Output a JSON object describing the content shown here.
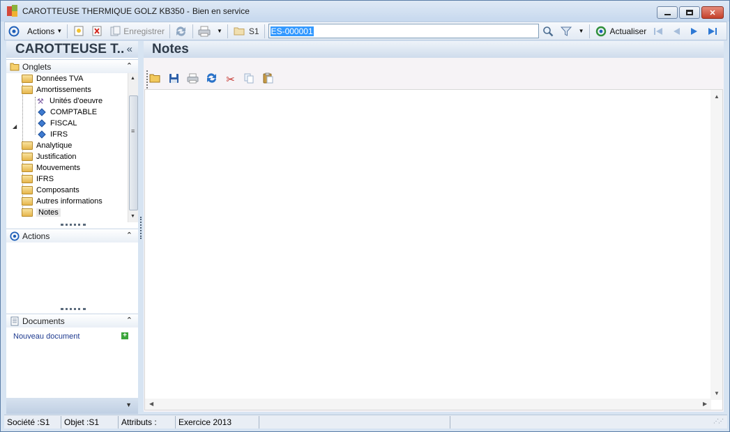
{
  "window": {
    "title": "CAROTTEUSE THERMIQUE GOLZ KB350 -",
    "status": "Bien en service",
    "buttons": {
      "minimize": "▭",
      "maximize": "□",
      "close": "✕"
    }
  },
  "toolbar": {
    "actions_label": "Actions",
    "save_label": "Enregistrer",
    "company_label": "S1",
    "search_value": "ES-000001",
    "refresh_label": "Actualiser"
  },
  "left_panel": {
    "header": "CAROTTEUSE T..",
    "collapse_icon": "«",
    "tabs_section": "Onglets",
    "tree": [
      {
        "label": "Données TVA",
        "type": "folder",
        "level": 0
      },
      {
        "label": "Amortissements",
        "type": "folder",
        "level": 0,
        "expanded": true
      },
      {
        "label": "Unités d'oeuvre",
        "type": "tool",
        "level": 1
      },
      {
        "label": "COMPTABLE",
        "type": "diamond",
        "level": 1
      },
      {
        "label": "FISCAL",
        "type": "diamond",
        "level": 1
      },
      {
        "label": "IFRS",
        "type": "diamond",
        "level": 1
      },
      {
        "label": "Analytique",
        "type": "folder",
        "level": 0
      },
      {
        "label": "Justification",
        "type": "folder",
        "level": 0
      },
      {
        "label": "Mouvements",
        "type": "folder",
        "level": 0
      },
      {
        "label": "IFRS",
        "type": "folder",
        "level": 0
      },
      {
        "label": "Composants",
        "type": "folder",
        "level": 0
      },
      {
        "label": "Autres informations",
        "type": "folder",
        "level": 0
      },
      {
        "label": "Notes",
        "type": "folder",
        "level": 0,
        "selected": true
      }
    ],
    "actions_section": "Actions",
    "documents_section": "Documents",
    "new_document": "Nouveau document"
  },
  "main": {
    "title": "Notes"
  },
  "statusbar": {
    "societe": "Société :S1",
    "objet": "Objet :S1",
    "attributs": "Attributs :",
    "exercice": "Exercice 2013"
  },
  "colors": {
    "window_bg": "#d7e4f2",
    "header_text": "#2f3b49",
    "selection": "#3399ff",
    "link": "#1e3a8f"
  }
}
